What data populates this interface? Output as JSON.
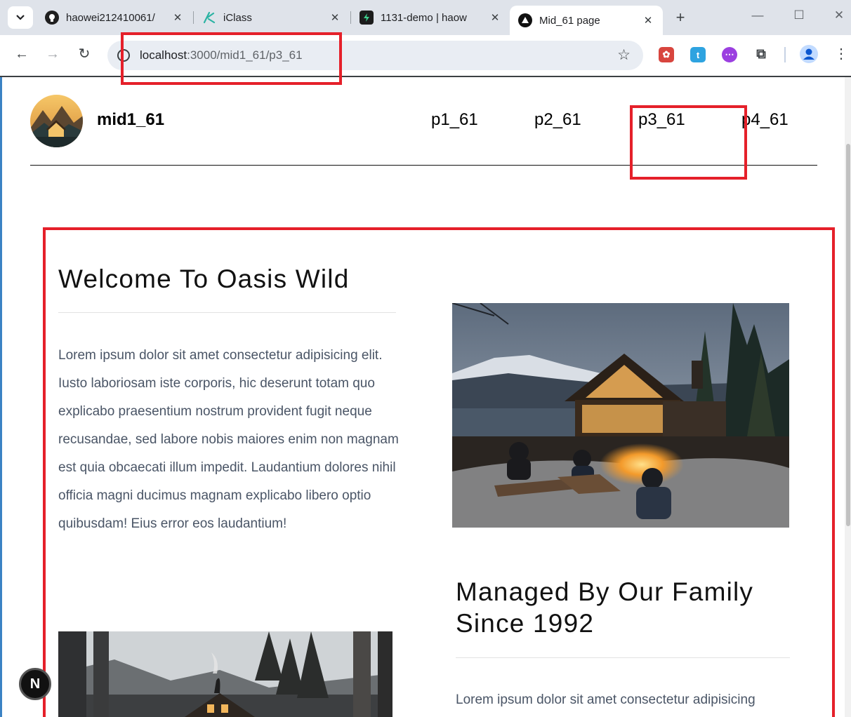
{
  "browser": {
    "tabs": [
      {
        "label": "haowei212410061/",
        "icon": "github-icon"
      },
      {
        "label": "iClass",
        "icon": "iclass-icon"
      },
      {
        "label": "1131-demo | haow",
        "icon": "supabase-icon"
      },
      {
        "label": "Mid_61 page",
        "icon": "nextjs-triangle-icon"
      }
    ],
    "address": {
      "host": "localhost",
      "rest": ":3000/mid1_61/p3_61"
    },
    "extensions": [
      "puzzle-extension-red",
      "t-extension",
      "chat-extension-purple",
      "extensions-icon"
    ]
  },
  "site": {
    "brand": "mid1_61",
    "nav": [
      "p1_61",
      "p2_61",
      "p3_61",
      "p4_61"
    ]
  },
  "section1": {
    "title": "Welcome To Oasis Wild",
    "body": "Lorem ipsum dolor sit amet consectetur adipisicing elit. Iusto laboriosam iste corporis, hic deserunt totam quo explicabo praesentium nostrum provident fugit neque recusandae, sed labore nobis maiores enim non magnam est quia obcaecati illum impedit. Laudantium dolores nihil officia magni ducimus magnam explicabo libero optio quibusdam! Eius error eos laudantium!"
  },
  "section2": {
    "title_line1": "Managed By Our Family",
    "title_line2": "Since 1992",
    "body": "Lorem ipsum dolor sit amet consectetur adipisicing"
  },
  "dev_badge": "N",
  "colors": {
    "annotation": "#e5202a",
    "body_text": "#4a5566"
  }
}
